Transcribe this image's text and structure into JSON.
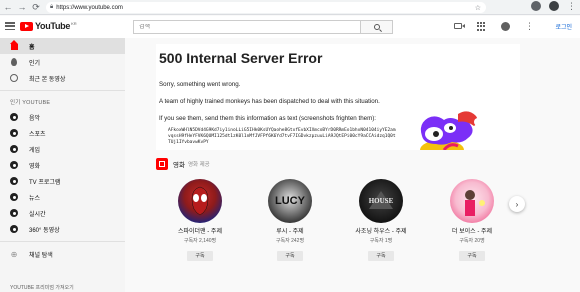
{
  "browser": {
    "url": "https://www.youtube.com"
  },
  "masthead": {
    "logo_text": "YouTube",
    "logo_region": "KR",
    "search_placeholder": "검색",
    "login_label": "로그인"
  },
  "sidebar": {
    "items": [
      {
        "label": "홈",
        "icon": "home-icon",
        "active": true
      },
      {
        "label": "인기",
        "icon": "fire-icon"
      },
      {
        "label": "최근 본 동영상",
        "icon": "history-icon"
      }
    ],
    "section_title": "인기 YOUTUBE",
    "channels": [
      {
        "label": "음악"
      },
      {
        "label": "스포츠"
      },
      {
        "label": "게임"
      },
      {
        "label": "영화"
      },
      {
        "label": "TV 프로그램"
      },
      {
        "label": "뉴스"
      },
      {
        "label": "실시간"
      },
      {
        "label": "360° 동영상"
      }
    ],
    "browse_label": "채널 탐색",
    "bottom_text": "YOUTUBE 프리미엄 가져오기"
  },
  "error": {
    "title": "500 Internal Server Error",
    "line1": "Sorry, something went wrong.",
    "line2": "A team of highly trained monkeys has been dispatched to deal with this situation.",
    "line3": "If you see them, send them this information as text (screenshots frighten them):",
    "code": "AFkoxWHlN5DVd4G9Kd7iy1inoLLiG5IHk0KsUYQaohe8GtxfEvbXIXmcoBYrD0RRmEo1bhxN04104iyYE2amvqssH9fHeYFVK6QUMI125dt1zK0l1nMfJVFPf6K6Yd7tvF7IGDvkzpzuuLiA9JQtEPi00cY9aCCAidzq1Q0tTUj1IYvbavwKvPY"
  },
  "shelf": {
    "title": "영화",
    "subtitle": "영화 제공",
    "channels": [
      {
        "name": "스파이더맨 - 주제",
        "subs": "구독자 2,140명",
        "button": "구독"
      },
      {
        "name": "루시 - 주제",
        "subs": "구독자 242명",
        "button": "구독"
      },
      {
        "name": "사조닝 하우스 - 주제",
        "subs": "구독자 1명",
        "button": "구독"
      },
      {
        "name": "더 보이스 - 주제",
        "subs": "구독자 20명",
        "button": "구독"
      }
    ],
    "avatar_texts": [
      "",
      "LUCY",
      "HOUSE",
      ""
    ]
  },
  "colors": {
    "brand_red": "#ff0000",
    "link_blue": "#065fd4"
  }
}
